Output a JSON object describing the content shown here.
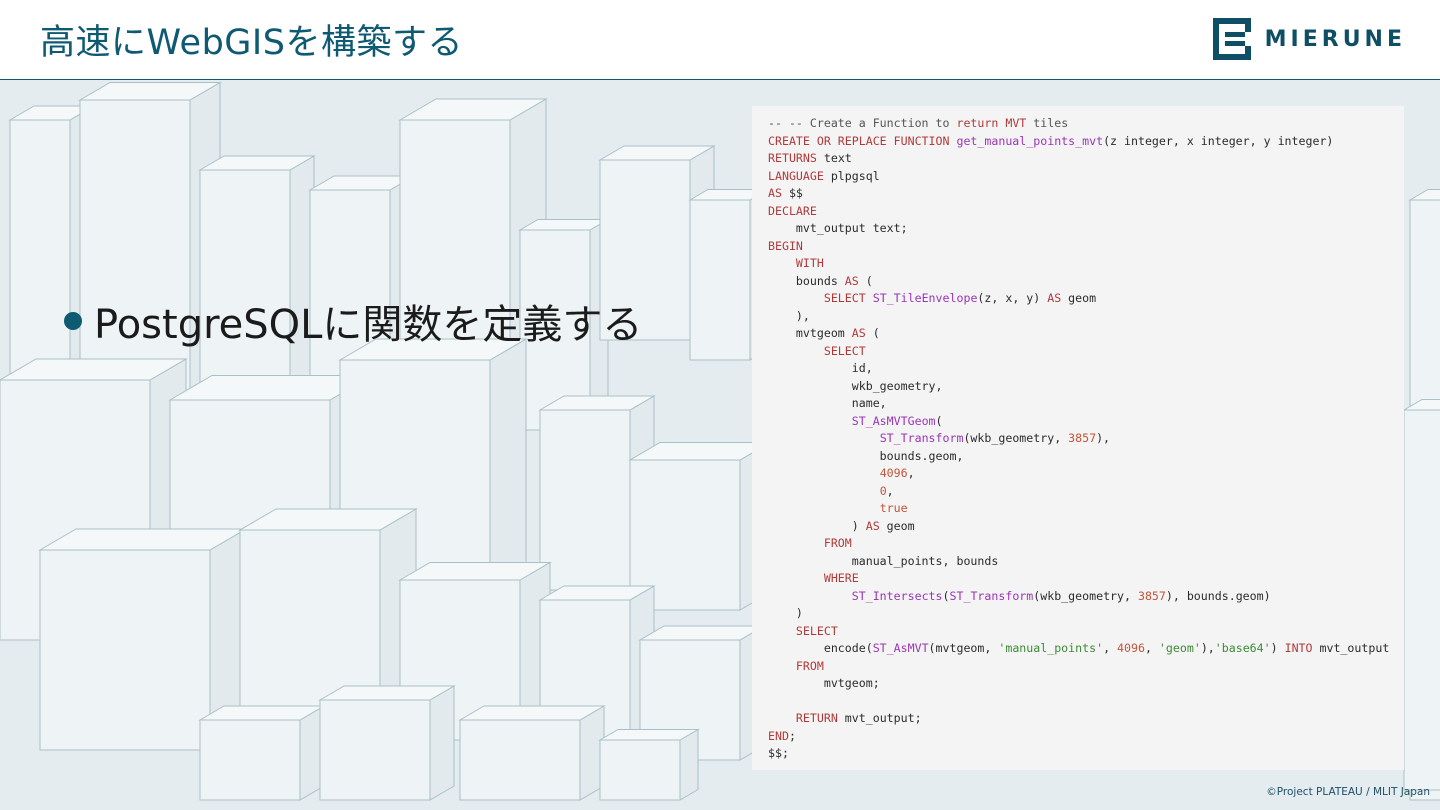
{
  "slide": {
    "title": "高速にWebGISを構築する",
    "logo_text": "MIERUNE",
    "bullet": "PostgreSQLに関数を定義する",
    "credit": "©Project PLATEAU / MLIT Japan",
    "colors": {
      "brand": "#0f5a73",
      "keyword": "#b03a3a",
      "function": "#9a36b8",
      "string": "#3d8a36",
      "number": "#c2553a",
      "code_bg": "#f4f4f4"
    }
  },
  "code_lines": [
    [
      [
        "cm",
        "-- -- Create a Function to "
      ],
      [
        "kw",
        "return"
      ],
      [
        "cm",
        " "
      ],
      [
        "kw",
        "MVT"
      ],
      [
        "cm",
        " tiles"
      ]
    ],
    [
      [
        "kw",
        "CREATE OR REPLACE FUNCTION"
      ],
      [
        "plain",
        " "
      ],
      [
        "fn",
        "get_manual_points_mvt"
      ],
      [
        "plain",
        "(z integer, x integer, y integer)"
      ]
    ],
    [
      [
        "kw",
        "RETURNS"
      ],
      [
        "plain",
        " text"
      ]
    ],
    [
      [
        "kw",
        "LANGUAGE"
      ],
      [
        "plain",
        " plpgsql"
      ]
    ],
    [
      [
        "kw",
        "AS"
      ],
      [
        "plain",
        " $$"
      ]
    ],
    [
      [
        "kw",
        "DECLARE"
      ]
    ],
    [
      [
        "plain",
        "    mvt_output text;"
      ]
    ],
    [
      [
        "kw",
        "BEGIN"
      ]
    ],
    [
      [
        "plain",
        "    "
      ],
      [
        "kw",
        "WITH"
      ]
    ],
    [
      [
        "plain",
        "    bounds "
      ],
      [
        "kw",
        "AS"
      ],
      [
        "plain",
        " ("
      ]
    ],
    [
      [
        "plain",
        "        "
      ],
      [
        "kw",
        "SELECT"
      ],
      [
        "plain",
        " "
      ],
      [
        "fn",
        "ST_TileEnvelope"
      ],
      [
        "plain",
        "(z, x, y) "
      ],
      [
        "kw",
        "AS"
      ],
      [
        "plain",
        " geom"
      ]
    ],
    [
      [
        "plain",
        "    ),"
      ]
    ],
    [
      [
        "plain",
        "    mvtgeom "
      ],
      [
        "kw",
        "AS"
      ],
      [
        "plain",
        " ("
      ]
    ],
    [
      [
        "plain",
        "        "
      ],
      [
        "kw",
        "SELECT"
      ]
    ],
    [
      [
        "plain",
        "            id,"
      ]
    ],
    [
      [
        "plain",
        "            wkb_geometry,"
      ]
    ],
    [
      [
        "plain",
        "            name,"
      ]
    ],
    [
      [
        "plain",
        "            "
      ],
      [
        "fn",
        "ST_AsMVTGeom"
      ],
      [
        "plain",
        "("
      ]
    ],
    [
      [
        "plain",
        "                "
      ],
      [
        "fn",
        "ST_Transform"
      ],
      [
        "plain",
        "(wkb_geometry, "
      ],
      [
        "num",
        "3857"
      ],
      [
        "plain",
        "),"
      ]
    ],
    [
      [
        "plain",
        "                bounds.geom,"
      ]
    ],
    [
      [
        "plain",
        "                "
      ],
      [
        "num",
        "4096"
      ],
      [
        "plain",
        ","
      ]
    ],
    [
      [
        "plain",
        "                "
      ],
      [
        "num",
        "0"
      ],
      [
        "plain",
        ","
      ]
    ],
    [
      [
        "plain",
        "                "
      ],
      [
        "num",
        "true"
      ]
    ],
    [
      [
        "plain",
        "            ) "
      ],
      [
        "kw",
        "AS"
      ],
      [
        "plain",
        " geom"
      ]
    ],
    [
      [
        "plain",
        "        "
      ],
      [
        "kw",
        "FROM"
      ]
    ],
    [
      [
        "plain",
        "            manual_points, bounds"
      ]
    ],
    [
      [
        "plain",
        "        "
      ],
      [
        "kw",
        "WHERE"
      ]
    ],
    [
      [
        "plain",
        "            "
      ],
      [
        "fn",
        "ST_Intersects"
      ],
      [
        "plain",
        "("
      ],
      [
        "fn",
        "ST_Transform"
      ],
      [
        "plain",
        "(wkb_geometry, "
      ],
      [
        "num",
        "3857"
      ],
      [
        "plain",
        "), bounds.geom)"
      ]
    ],
    [
      [
        "plain",
        "    )"
      ]
    ],
    [
      [
        "plain",
        "    "
      ],
      [
        "kw",
        "SELECT"
      ]
    ],
    [
      [
        "plain",
        "        encode("
      ],
      [
        "fn",
        "ST_AsMVT"
      ],
      [
        "plain",
        "(mvtgeom, "
      ],
      [
        "str",
        "'manual_points'"
      ],
      [
        "plain",
        ", "
      ],
      [
        "num",
        "4096"
      ],
      [
        "plain",
        ", "
      ],
      [
        "str",
        "'geom'"
      ],
      [
        "plain",
        "),"
      ],
      [
        "str",
        "'base64'"
      ],
      [
        "plain",
        ") "
      ],
      [
        "kw",
        "INTO"
      ],
      [
        "plain",
        " mvt_output"
      ]
    ],
    [
      [
        "plain",
        "    "
      ],
      [
        "kw",
        "FROM"
      ]
    ],
    [
      [
        "plain",
        "        mvtgeom;"
      ]
    ],
    [
      [
        "plain",
        ""
      ]
    ],
    [
      [
        "plain",
        "    "
      ],
      [
        "kw",
        "RETURN"
      ],
      [
        "plain",
        " mvt_output;"
      ]
    ],
    [
      [
        "kw",
        "END"
      ],
      [
        "plain",
        ";"
      ]
    ],
    [
      [
        "plain",
        "$$;"
      ]
    ]
  ]
}
